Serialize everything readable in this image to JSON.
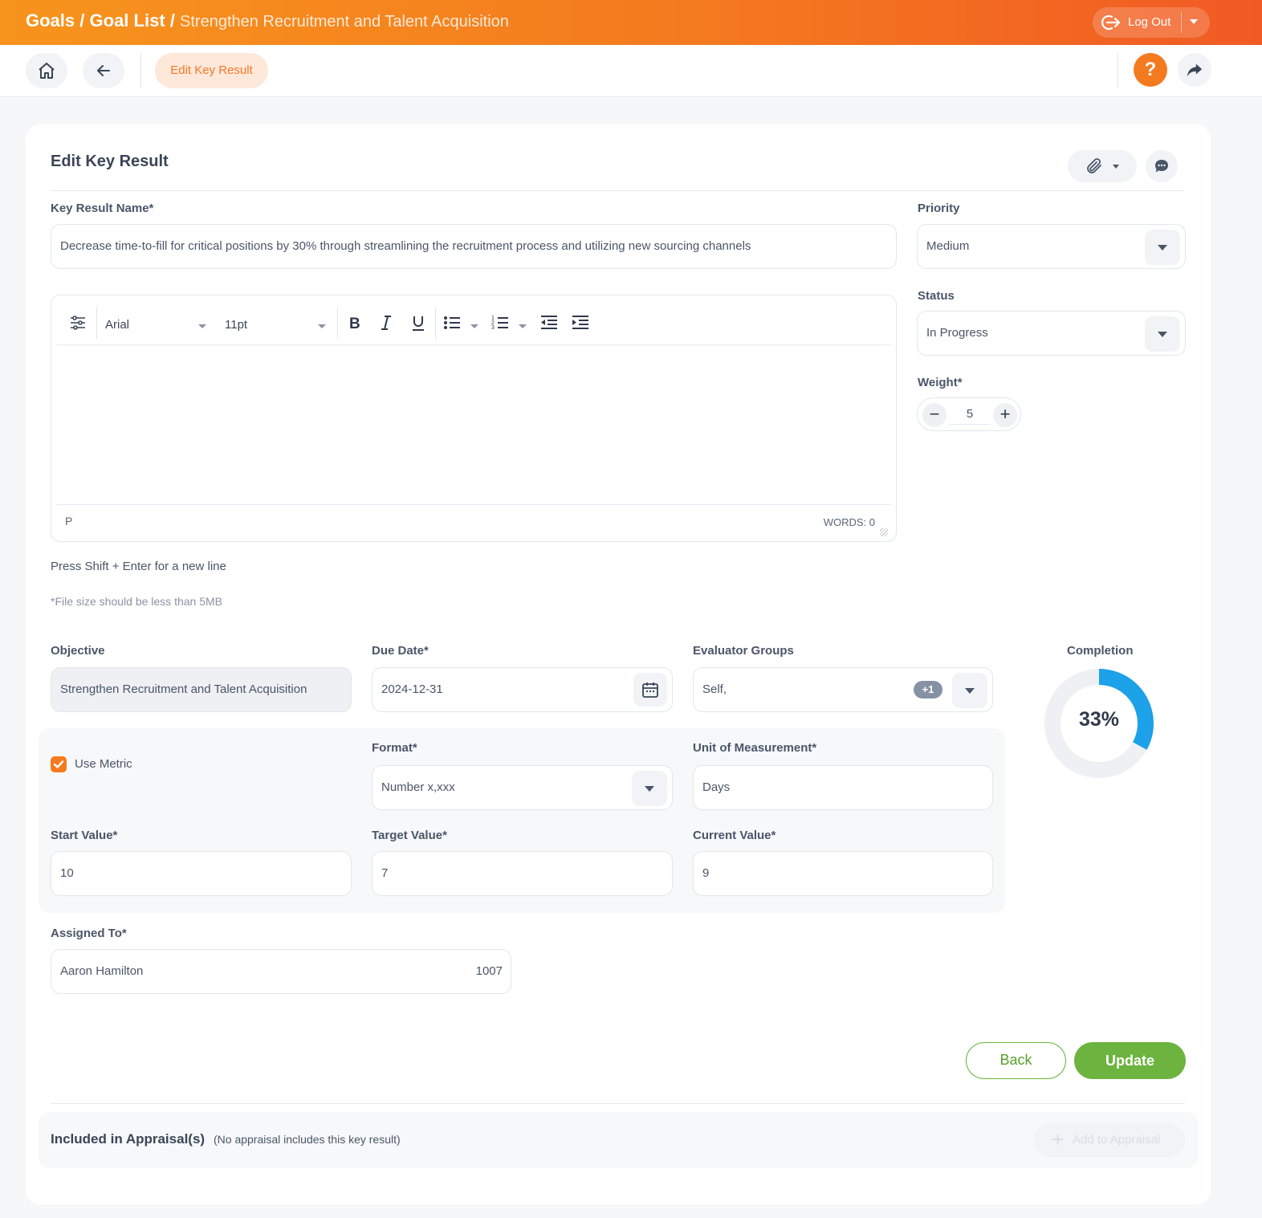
{
  "breadcrumbs": {
    "root": "Goals",
    "sep1": "/",
    "list": "Goal List",
    "sep2": "/",
    "current": "Strengthen Recruitment and Talent Acquisition"
  },
  "topbar": {
    "logout_label": "Log Out"
  },
  "nav": {
    "active_tab": "Edit Key Result",
    "help_label": "?"
  },
  "form": {
    "title": "Edit Key Result",
    "key_result_name_label": "Key Result Name*",
    "key_result_name_value": "Decrease time-to-fill for critical positions by 30% through streamlining the recruitment process and utilizing new sourcing channels",
    "priority_label": "Priority",
    "priority_value": "Medium",
    "status_label": "Status",
    "status_value": "In Progress",
    "weight_label": "Weight*",
    "weight_value": "5",
    "editor": {
      "font": "Arial",
      "size": "11pt",
      "path": "P",
      "words": "WORDS: 0"
    },
    "hint_newline": "Press Shift + Enter for a new line",
    "hint_filesize": "*File size should be less than 5MB",
    "objective_label": "Objective",
    "objective_value": "Strengthen Recruitment and Talent Acquisition",
    "due_date_label": "Due Date*",
    "due_date_value": "2024-12-31",
    "evaluator_label": "Evaluator Groups",
    "evaluator_value": "Self,",
    "evaluator_more": "+1",
    "completion_label": "Completion",
    "completion_text": "33%",
    "completion_fraction": 0.33,
    "use_metric_label": "Use Metric",
    "format_label": "Format*",
    "format_value": "Number x,xxx",
    "unit_label": "Unit of Measurement*",
    "unit_value": "Days",
    "start_label": "Start Value*",
    "start_value": "10",
    "target_label": "Target Value*",
    "target_value": "7",
    "current_label": "Current Value*",
    "current_value": "9",
    "assigned_label": "Assigned To*",
    "assigned_value": "Aaron Hamilton",
    "assigned_id": "1007",
    "back_label": "Back",
    "update_label": "Update"
  },
  "appraisal": {
    "title": "Included in Appraisal(s)",
    "subtitle": "(No appraisal includes this key result)",
    "add_label": "Add to Appraisal"
  },
  "colors": {
    "accent": "#f47a1f",
    "success": "#6db33f",
    "progress": "#1da1e8"
  }
}
